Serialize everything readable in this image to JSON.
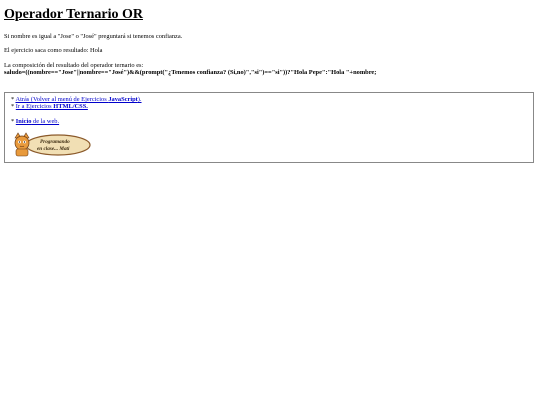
{
  "page": {
    "title": "Operador Ternario OR",
    "paragraph1": "Si nombre es igual a \"Jose\" o \"José\" preguntará si tenemos confianza.",
    "paragraph2": "El ejercicio saca como resultado: Hola",
    "paragraph3_label": "La composición del resultado del operador ternario es:",
    "paragraph3_code": "saludo=((nombre==\"Jose\"||nombre==\"José\")&&(prompt(\"¿Tenemos confianza? (Si,no)\",\"si\")==\"si\"))?\"Hola Pepe\":\"Hola \"+nombre;"
  },
  "nav": {
    "back_prefix": "* ",
    "back_link_text": "Atrás (Volver al menú de Ejercicios ",
    "back_link_bold": "JavaScript",
    "back_link_suffix": ").",
    "exercises_prefix": "* ",
    "exercises_link_text": "Ir a Ejercicios ",
    "exercises_link_bold": "HTML/CSS.",
    "home_prefix": "* ",
    "home_link_bold": "Inicio",
    "home_link_text": " de la web."
  },
  "logo": {
    "line1": "Programando",
    "line2": "en clase... Mati"
  },
  "colors": {
    "link": "#0000cc",
    "border": "#888888",
    "logo_fill": "#f1dfb4",
    "logo_stroke": "#8b5a2b",
    "cat": "#e89a3c"
  }
}
